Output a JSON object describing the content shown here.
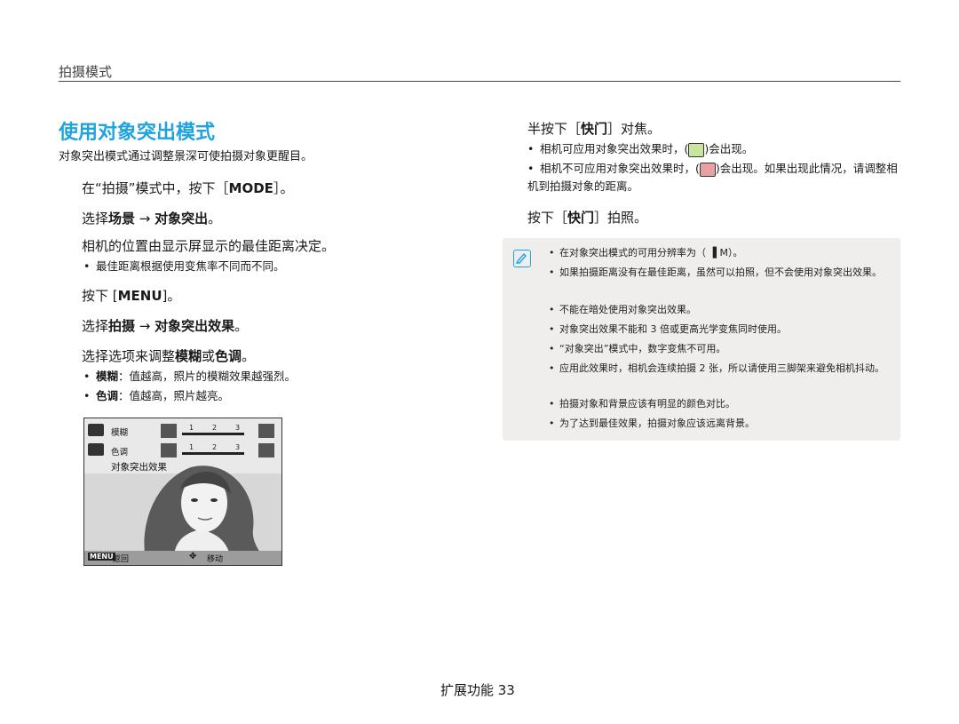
{
  "header": {
    "section": "拍摄模式"
  },
  "left": {
    "title": "使用对象突出模式",
    "intro": "对象突出模式通过调整景深可使拍摄对象更醒目。",
    "step1": {
      "pre": "在“拍摄”模式中，按下［",
      "key": "MODE",
      "post": "］。"
    },
    "step2": {
      "pre": "选择",
      "b1": "场景",
      "arrow": " → ",
      "b2": "对象突出",
      "post": "。"
    },
    "step3": "相机的位置由显示屏显示的最佳距离决定。",
    "step3_bullet": "最佳距离根据使用变焦率不同而不同。",
    "step4": {
      "pre": "按下 [",
      "key": "MENU",
      "post": "]。"
    },
    "step5": {
      "pre": "选择",
      "b1": "拍摄",
      "arrow": " → ",
      "b2": "对象突出效果",
      "post": "。"
    },
    "step6": {
      "pre": "选择选项来调整",
      "b1": "模糊",
      "mid": "或",
      "b2": "色调",
      "post": "。"
    },
    "bullets": [
      {
        "term": "模糊",
        "text": "：值越高，照片的模糊效果越强烈。"
      },
      {
        "term": "色调",
        "text": "：值越高，照片越亮。"
      }
    ],
    "screen": {
      "row1_label": "模糊",
      "row2_label": "色调",
      "scale": [
        "1",
        "2",
        "3"
      ],
      "caption": "对象突出效果",
      "bottom_menu": "MENU",
      "bottom_back": "返回",
      "bottom_move": "移动"
    }
  },
  "right": {
    "step7": {
      "pre": "半按下［",
      "key": "快门",
      "post": "］对焦。"
    },
    "step7_bullets": [
      {
        "pre": "相机可应用对象突出效果时，(",
        "post": ")会出现。"
      },
      {
        "pre": "相机不可应用对象突出效果时，(",
        "post": ")会出现。如果出现此情况，请调整相机到拍摄对象的距离。"
      }
    ],
    "step8": {
      "pre": "按下［",
      "key": "快门",
      "post": "］拍照。"
    },
    "notes": [
      "在对象突出模式的可用分辨率为（ ▐ M）。",
      "如果拍摄距离没有在最佳距离，虽然可以拍照，但不会使用对象突出效果。",
      "不能在暗处使用对象突出效果。",
      "对象突出效果不能和 3 倍或更高光学变焦同时使用。",
      "“对象突出”模式中，数字变焦不可用。",
      "应用此效果时，相机会连续拍摄 2 张，所以请使用三脚架来避免相机抖动。",
      "拍摄对象和背景应该有明显的颜色对比。",
      "为了达到最佳效果，拍摄对象应该远离背景。"
    ]
  },
  "footer": {
    "page": "扩展功能 33"
  }
}
